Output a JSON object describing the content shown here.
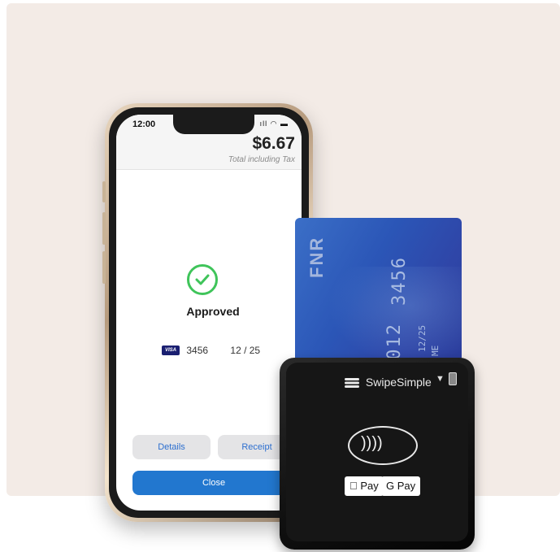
{
  "phone": {
    "status_time": "12:00",
    "status_icons": "••• ● ▬",
    "total_amount": "$6.67",
    "total_label": "Total including Tax",
    "approved_label": "Approved",
    "card_brand": "VISA",
    "card_last4": "3456",
    "card_expiry": "12 / 25",
    "buttons": {
      "details": "Details",
      "receipt": "Receipt",
      "close": "Close"
    }
  },
  "card": {
    "brand": "FNR",
    "number_part1": "3456",
    "number_part2": "9012",
    "expiry": "12/25",
    "name_fragment": "ME"
  },
  "reader": {
    "brand_label": "SwipeSimple",
    "led_arrow": "▼",
    "apple_pay": " Pay",
    "google_pay": "G Pay",
    "contactless_glyph": "))))"
  },
  "colors": {
    "accent": "#2277cf",
    "approved": "#3fc45a",
    "panel_bg": "#f3ebe6"
  }
}
